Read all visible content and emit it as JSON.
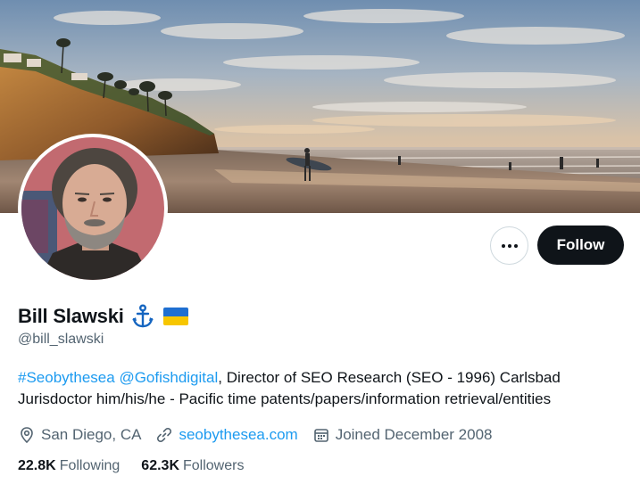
{
  "profile": {
    "display_name": "Bill Slawski",
    "handle": "@bill_slawski",
    "name_emojis": [
      "anchor-icon",
      "ukraine-flag-icon"
    ],
    "bio": {
      "hashtag": "#Seobythesea",
      "mention": "@Gofishdigital",
      "text_line1": ", Director of SEO Research  (SEO - 1996) Carlsbad",
      "text_line2": "Jurisdoctor him/his/he - Pacific time patents/papers/information retrieval/entities"
    },
    "location": "San Diego, CA",
    "website": "seobythesea.com",
    "joined": "Joined December 2008",
    "following_count": "22.8K",
    "following_label": "Following",
    "followers_count": "62.3K",
    "followers_label": "Followers"
  },
  "actions": {
    "more_icon": "more-horizontal-icon",
    "follow_label": "Follow"
  },
  "colors": {
    "link": "#1d9bf0",
    "text": "#0f1419",
    "secondary": "#536471",
    "button_dark": "#0f1419",
    "border": "#cfd9de"
  }
}
